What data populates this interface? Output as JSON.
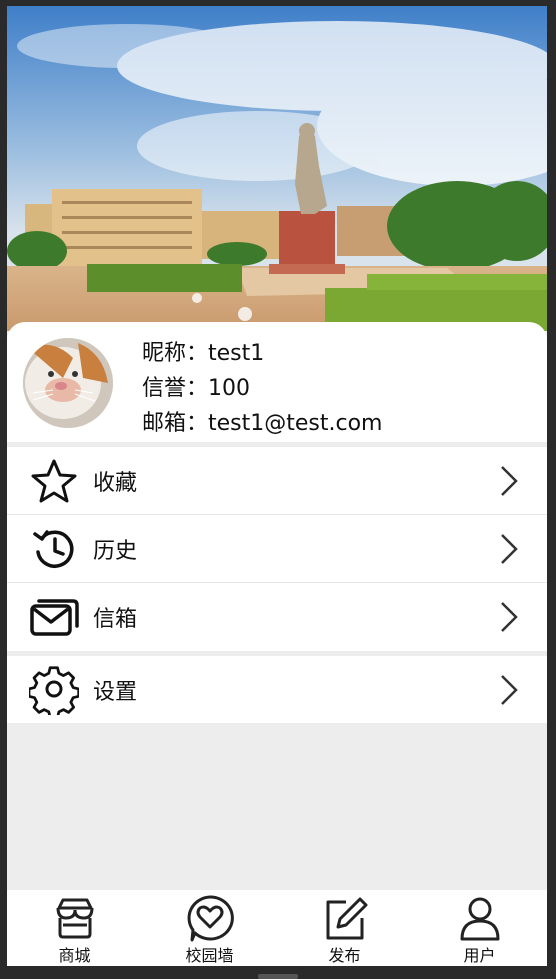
{
  "profile": {
    "nickname_label": "昵称：",
    "nickname": "test1",
    "credit_label": "信誉：",
    "credit": "100",
    "email_label": "邮箱：",
    "email": "test1@test.com"
  },
  "menu": {
    "favorites": "收藏",
    "history": "历史",
    "mailbox": "信箱",
    "settings": "设置"
  },
  "tabbar": {
    "shop": "商城",
    "campus_wall": "校园墙",
    "publish": "发布",
    "user": "用户"
  }
}
